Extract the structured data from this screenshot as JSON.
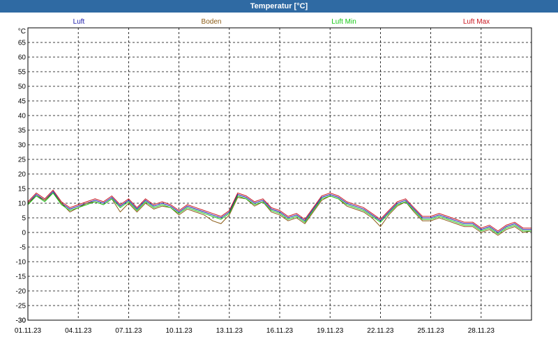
{
  "window": {
    "title": "Temperatur [°C]"
  },
  "chart_data": {
    "type": "line",
    "title": "Temperatur [°C]",
    "ylabel": "°C",
    "ylim": [
      -30,
      70
    ],
    "xlim": [
      0,
      30
    ],
    "grid": true,
    "legend_position": "top",
    "yticks": [
      -30,
      -25,
      -20,
      -15,
      -10,
      -5,
      0,
      5,
      10,
      15,
      20,
      25,
      30,
      35,
      40,
      45,
      50,
      55,
      60,
      65
    ],
    "xticks": [
      {
        "x": 0,
        "label": "01.11.23"
      },
      {
        "x": 3,
        "label": "04.11.23"
      },
      {
        "x": 6,
        "label": "07.11.23"
      },
      {
        "x": 9,
        "label": "10.11.23"
      },
      {
        "x": 12,
        "label": "13.11.23"
      },
      {
        "x": 15,
        "label": "16.11.23"
      },
      {
        "x": 18,
        "label": "19.11.23"
      },
      {
        "x": 21,
        "label": "22.11.23"
      },
      {
        "x": 24,
        "label": "25.11.23"
      },
      {
        "x": 27,
        "label": "28.11.23"
      }
    ],
    "x": [
      0,
      0.5,
      1,
      1.5,
      2,
      2.5,
      3,
      3.5,
      4,
      4.5,
      5,
      5.5,
      6,
      6.5,
      7,
      7.5,
      8,
      8.5,
      9,
      9.5,
      10,
      10.5,
      11,
      11.5,
      12,
      12.5,
      13,
      13.5,
      14,
      14.5,
      15,
      15.5,
      16,
      16.5,
      17,
      17.5,
      18,
      18.5,
      19,
      19.5,
      20,
      20.5,
      21,
      21.5,
      22,
      22.5,
      23,
      23.5,
      24,
      24.5,
      25,
      25.5,
      26,
      26.5,
      27,
      27.5,
      28,
      28.5,
      29,
      29.5,
      30
    ],
    "series": [
      {
        "name": "Luft",
        "color": "#1a1aa8",
        "values": [
          10,
          13,
          11,
          14,
          10,
          8,
          9,
          10,
          11,
          10,
          12,
          9,
          11,
          8,
          11,
          9,
          10,
          9,
          7,
          9,
          8,
          7,
          6,
          5,
          7,
          13,
          12,
          10,
          11,
          8,
          7,
          5,
          6,
          4,
          8,
          12,
          13,
          12,
          10,
          9,
          8,
          6,
          4,
          7,
          10,
          11,
          8,
          5,
          5,
          6,
          5,
          4,
          3,
          3,
          1,
          2,
          0,
          2,
          3,
          1,
          1
        ]
      },
      {
        "name": "Boden",
        "color": "#8a5a14",
        "values": [
          10,
          12.5,
          11,
          13.5,
          10,
          7,
          8.5,
          10,
          10.5,
          9.5,
          11.5,
          7,
          10,
          7,
          10,
          8,
          9,
          8.5,
          6,
          8,
          7,
          6,
          4,
          3,
          6,
          12,
          11.5,
          9,
          10.5,
          7,
          6,
          4,
          5,
          3,
          7,
          11,
          12.5,
          11.5,
          9,
          8,
          7,
          5,
          2,
          6,
          9,
          10.5,
          7,
          4,
          4,
          5,
          4,
          3,
          2,
          2,
          0,
          1,
          -1,
          1,
          2,
          0,
          0.5
        ]
      },
      {
        "name": "Luft Min",
        "color": "#16c816",
        "values": [
          9.5,
          12.5,
          10.5,
          13.5,
          9.5,
          7.5,
          8.5,
          9.5,
          10.5,
          9.5,
          11.5,
          8.5,
          10.5,
          7.5,
          10.5,
          8.5,
          9.5,
          8.5,
          6.5,
          8.5,
          7.5,
          6.5,
          5.5,
          4.5,
          6.5,
          12.5,
          11.5,
          9.5,
          10.5,
          7.5,
          6.5,
          4.5,
          5.5,
          3.5,
          7.5,
          11.5,
          12.5,
          11.5,
          9.5,
          8.5,
          7.5,
          5.5,
          3.5,
          6.5,
          9.5,
          10.5,
          7.5,
          4.5,
          4.5,
          5.5,
          4.5,
          3.5,
          2.5,
          2.5,
          0.5,
          1.5,
          -0.5,
          1.5,
          2.5,
          0.5,
          0.5
        ]
      },
      {
        "name": "Luft Max",
        "color": "#c8141e",
        "values": [
          10.5,
          13.5,
          11.5,
          14.5,
          10.5,
          8.5,
          9.5,
          10.5,
          11.5,
          10.5,
          12.5,
          9.5,
          11.5,
          8.5,
          11.5,
          9.5,
          10.5,
          9.5,
          7.5,
          9.5,
          8.5,
          7.5,
          6.5,
          5.5,
          7.5,
          13.5,
          12.5,
          10.5,
          11.5,
          8.5,
          7.5,
          5.5,
          6.5,
          4.5,
          8.5,
          12.5,
          13.5,
          12.5,
          10.5,
          9.5,
          8.5,
          6.5,
          4.5,
          7.5,
          10.5,
          11.5,
          8.5,
          5.5,
          5.5,
          6.5,
          5.5,
          4.5,
          3.5,
          3.5,
          1.5,
          2.5,
          0.5,
          2.5,
          3.5,
          1.5,
          1.5
        ]
      }
    ]
  }
}
